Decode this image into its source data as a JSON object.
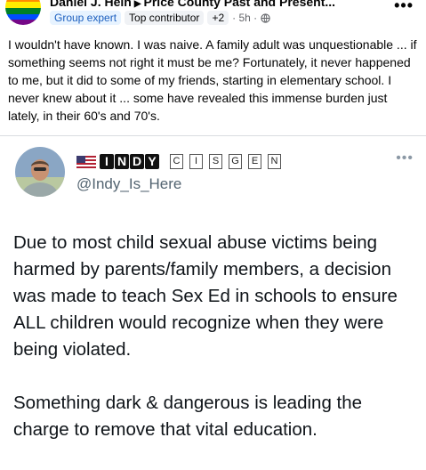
{
  "post": {
    "author": "Daniel J. Hein",
    "group": "Price County Past and Present...",
    "badges": [
      "Group expert",
      "Top contributor",
      "+2"
    ],
    "time": "· 5h ·",
    "text": "I wouldn't have known.  I was naive.  A family adult was unquestionable ... if something seems not right it must be me?  Fortunately, it never happened to me, but it did to some of my friends, starting in elementary school.  I never knew about it ... some have revealed this immense burden just lately, in their 60's and 70's.",
    "more_icon": "•••"
  },
  "tweet": {
    "name_block_letters": [
      "I",
      "N",
      "D",
      "Y"
    ],
    "name_box_letters": [
      "C",
      "I",
      "S",
      "G",
      "E",
      "N"
    ],
    "handle": "@Indy_Is_Here",
    "more_icon": "•••",
    "paragraph1": "Due to most child sexual abuse victims being harmed by parents/family members, a decision was made to teach Sex Ed in schools to ensure ALL children would recognize when they were being violated.",
    "paragraph2": "Something dark & dangerous is leading the charge to remove that vital education."
  }
}
